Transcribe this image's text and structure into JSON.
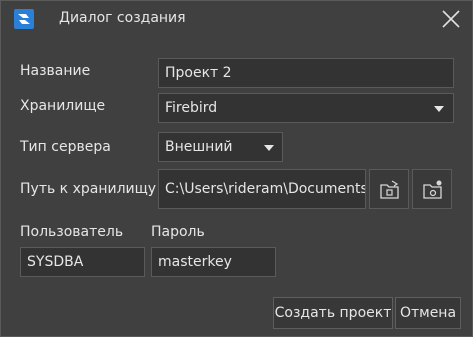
{
  "window": {
    "title": "Диалог создания",
    "app_icon": "app-logo-icon",
    "close_icon": "close-icon",
    "accent": "#2b7fd6"
  },
  "form": {
    "name": {
      "label": "Название",
      "value": "Проект 2"
    },
    "storage": {
      "label": "Хранилище",
      "value": "Firebird"
    },
    "server_type": {
      "label": "Тип сервера",
      "value": "Внешний"
    },
    "path": {
      "label": "Путь к хранилищу",
      "value": "C:\\Users\\rideram\\Documents\\",
      "browse_icon": "browse-folder-icon",
      "settings_icon": "folder-settings-icon"
    },
    "user": {
      "label": "Пользователь",
      "value": "SYSDBA"
    },
    "password": {
      "label": "Пароль",
      "value": "masterkey"
    }
  },
  "buttons": {
    "create": "Создать проект",
    "cancel": "Отмена"
  }
}
